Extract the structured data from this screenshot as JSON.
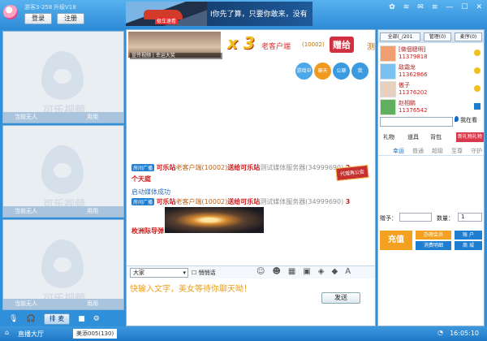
{
  "titlebar": {
    "guest_label": "游客3-258",
    "version_label": "升级V18",
    "login_label": "登录",
    "register_label": "注册",
    "banner_tag": "极车速看",
    "banner_text": "I你先了算，只要你敢来，没有"
  },
  "videos": [
    {
      "brand": "可乐视频",
      "status": "当前无人",
      "permission": "用用"
    },
    {
      "brand": "可乐视频",
      "status": "当前无人",
      "permission": "用用"
    },
    {
      "brand": "可乐视频",
      "status": "当前无人",
      "permission": "用用"
    }
  ],
  "mic_bar": {
    "speak_label": "排 麦"
  },
  "gift_strip": {
    "thumb_label": "宣传视频 | 幸运大奖",
    "multiplier": "x 3",
    "sender": "老客户端",
    "sender_id": "(10002)",
    "gift_word": "赠给",
    "overflow_char": "测"
  },
  "circles": [
    "游戏中心",
    "聊天",
    "公聊",
    "我"
  ],
  "messages": {
    "m1_tag": "房间广播",
    "m1_from": "可乐站",
    "m1_mid": "老客户端(10002)",
    "m1_verb": "送给",
    "m1_to": "可乐站",
    "m1_server": "测试媒体服务器(34999690)",
    "m1_count": "2",
    "m1_gift": "个天庭",
    "media_status": "启动媒体成功",
    "m2_tag": "房间广播",
    "m2_from": "可乐站",
    "m2_mid": "老客户端(10002)",
    "m2_verb": "送给",
    "m2_to": "可乐站",
    "m2_server": "测试媒体服务器(34999690)",
    "m2_count": "3",
    "m2_gift": "枚洲际导弹",
    "notice_stamp": "代理再公告"
  },
  "input": {
    "target": "大家",
    "private_label": "悄悄话",
    "placeholder": "快输入文字，美女等待你聊天呦！",
    "send_label": "发送"
  },
  "right": {
    "filter_label": "全部(_/201",
    "manage_label": "管理(0)",
    "queue_label": "麦序(0)",
    "users": [
      {
        "name": "[做個聰明]",
        "id": "11379818"
      },
      {
        "name": "敌霜龙",
        "id": "11362866"
      },
      {
        "name": "傲子",
        "id": "11376202"
      },
      {
        "name": "赵相鹏",
        "id": "11376542"
      }
    ],
    "search_btn": "我在看",
    "tabs": [
      "礼物",
      "道具",
      "背包"
    ],
    "special_gift": "新礼物礼物",
    "sub_tabs": [
      "幸运",
      "普通",
      "超级",
      "至尊",
      "守护"
    ],
    "gift_to_label": "赠予：",
    "qty_label": "数量：",
    "qty_value": "1",
    "recharge_label": "充值",
    "vip_label": "办理会员",
    "account_label": "账 户",
    "consume_label": "消费明细",
    "mall_label": "商 城"
  },
  "statusbar": {
    "hall_label": "直播大厅",
    "room_label": "美添005(130)",
    "clock": "16:05:10"
  }
}
